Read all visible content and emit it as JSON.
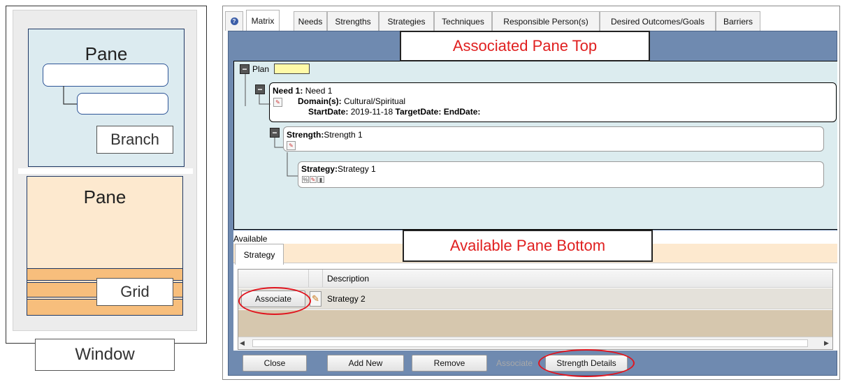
{
  "diagram": {
    "top_pane_label": "Pane",
    "branch_label": "Branch",
    "bottom_pane_label": "Pane",
    "grid_label": "Grid",
    "window_label": "Window"
  },
  "tabs": [
    {
      "label": ""
    },
    {
      "label": "Matrix"
    },
    {
      "label": "Needs"
    },
    {
      "label": "Strengths"
    },
    {
      "label": "Strategies"
    },
    {
      "label": "Techniques"
    },
    {
      "label": "Responsible Person(s)"
    },
    {
      "label": "Desired Outcomes/Goals"
    },
    {
      "label": "Barriers"
    }
  ],
  "callouts": {
    "top": "Associated Pane Top",
    "bottom": "Available Pane Bottom"
  },
  "tree": {
    "plan_label": "Plan",
    "need": {
      "title": "Need 1:",
      "name": "Need 1",
      "domain_label": "Domain(s):",
      "domain_value": "Cultural/Spiritual",
      "start_label": "StartDate:",
      "start_value": "2019-11-18",
      "target_label": "TargetDate:",
      "end_label": "EndDate:"
    },
    "strength": {
      "title": "Strength:",
      "name": "Strength 1"
    },
    "strategy": {
      "title": "Strategy:",
      "name": "Strategy 1"
    }
  },
  "available": {
    "label": "Available",
    "tab": "Strategy",
    "grid": {
      "column_description": "Description",
      "rows": [
        {
          "action": "Associate",
          "description": "Strategy 2"
        }
      ]
    }
  },
  "footer": {
    "close": "Close",
    "add_new": "Add New",
    "remove": "Remove",
    "associate": "Associate",
    "strength_details": "Strength Details"
  },
  "colors": {
    "callout_text": "#e02020",
    "highlight_ellipse": "#e0141e",
    "frame_blue": "#6f8ab0",
    "pane_blue": "#dcebf0",
    "pane_peach": "#fde9cf",
    "grid_band": "#f7be7c"
  }
}
